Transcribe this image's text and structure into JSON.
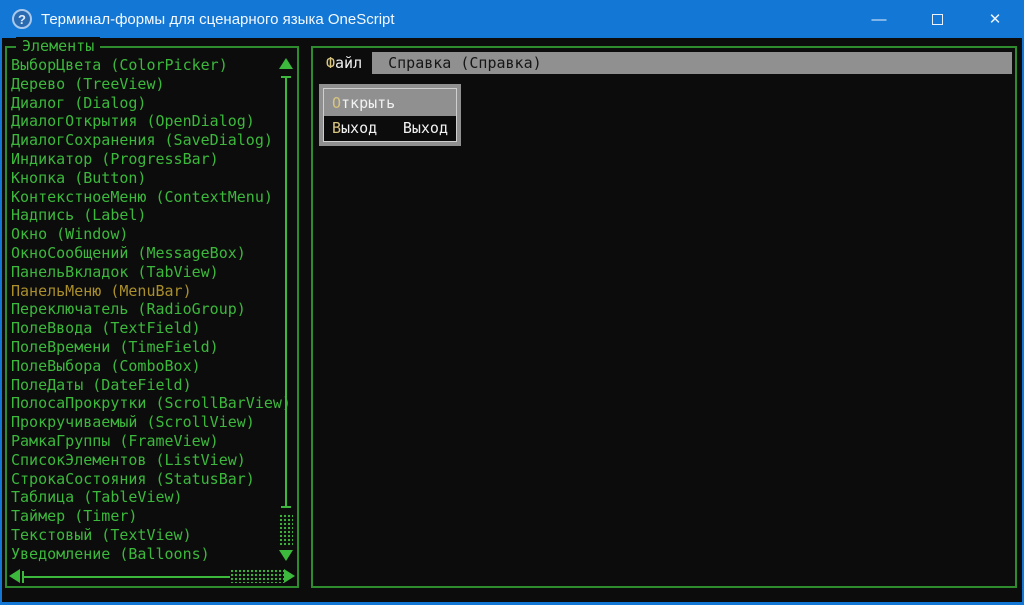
{
  "titlebar": {
    "icon_glyph": "?",
    "title": "Терминал-формы для сценарного языка OneScript",
    "minimize_glyph": "—",
    "close_glyph": "✕"
  },
  "left_panel": {
    "frame_title": "Элементы",
    "selected_index": 12,
    "items": [
      "ВыборЦвета (ColorPicker)",
      "Дерево (TreeView)",
      "Диалог (Dialog)",
      "ДиалогОткрытия (OpenDialog)",
      "ДиалогСохранения (SaveDialog)",
      "Индикатор (ProgressBar)",
      "Кнопка (Button)",
      "КонтекстноеМеню (ContextMenu)",
      "Надпись (Label)",
      "Окно (Window)",
      "ОкноСообщений (MessageBox)",
      "ПанельВкладок (TabView)",
      "ПанельМеню (MenuBar)",
      "Переключатель (RadioGroup)",
      "ПолеВвода (TextField)",
      "ПолеВремени (TimeField)",
      "ПолеВыбора (ComboBox)",
      "ПолеДаты (DateField)",
      "ПолосаПрокрутки (ScrollBarView)",
      "Прокручиваемый (ScrollView)",
      "РамкаГруппы (FrameView)",
      "СписокЭлементов (ListView)",
      "СтрокаСостояния (StatusBar)",
      "Таблица (TableView)",
      "Таймер (Timer)",
      "Текстовый (TextView)",
      "Уведомление (Balloons)"
    ]
  },
  "right_panel": {
    "menubar": [
      {
        "hot": "Ф",
        "rest": "айл",
        "selected": true
      },
      {
        "hot": "",
        "rest": "Справка (Справка)",
        "selected": false
      }
    ],
    "dropdown": [
      {
        "hot": "О",
        "rest": "ткрыть",
        "shortcut": "",
        "selected": false
      },
      {
        "hot": "В",
        "rest": "ыход",
        "shortcut": "Выход",
        "selected": true
      }
    ]
  },
  "colors": {
    "titlebar_bg": "#1377d6",
    "terminal_bg": "#0c0c0c",
    "green_text": "#3cb83c",
    "green_border": "#2e8b2e",
    "selected_item_yellow": "#aa8f2c",
    "menubar_bg": "#909090",
    "menu_selected_bg": "#0c0c0c",
    "hotkey_yellow": "#d9c581",
    "menu_text_dark": "#161616",
    "menu_text_white": "#f2f2f2"
  }
}
